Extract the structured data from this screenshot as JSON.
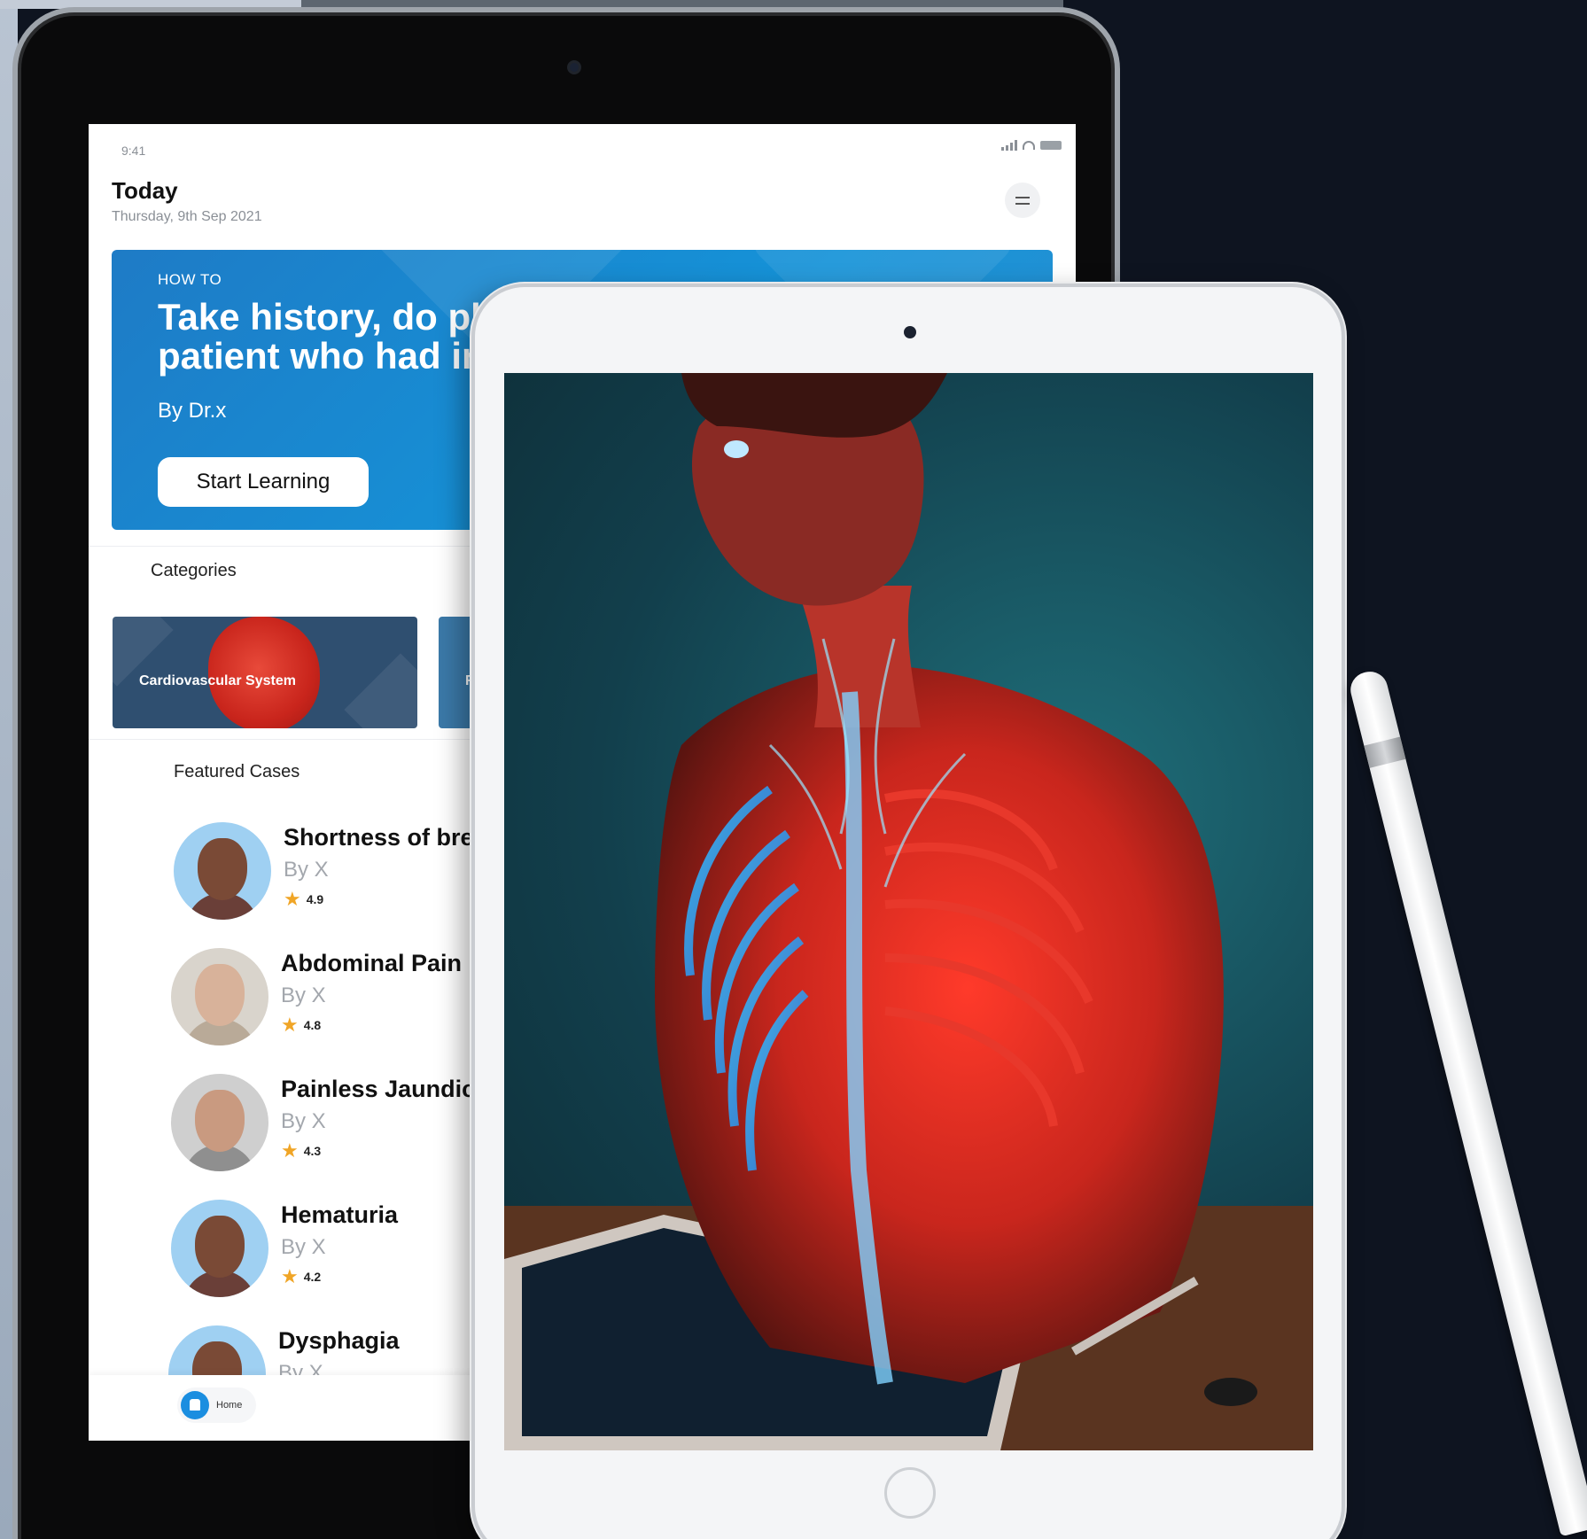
{
  "status_bar": {
    "time": "9:41"
  },
  "header": {
    "title": "Today",
    "date": "Thursday, 9th Sep 2021"
  },
  "hero": {
    "kicker": "HOW TO",
    "title": "Take history, do phy\npatient who had ing",
    "author": "By Dr.x",
    "button_label": "Start Learning"
  },
  "categories": {
    "heading": "Categories",
    "items": [
      {
        "label": "Cardiovascular System"
      },
      {
        "label": "Re"
      }
    ]
  },
  "featured": {
    "heading": "Featured Cases",
    "cases": [
      {
        "title": "Shortness of brea",
        "author": "By X",
        "rating": "4.9"
      },
      {
        "title": "Abdominal Pain",
        "author": "By X",
        "rating": "4.8"
      },
      {
        "title": "Painless Jaundice",
        "author": "By X",
        "rating": "4.3"
      },
      {
        "title": "Hematuria",
        "author": "By X",
        "rating": "4.2"
      },
      {
        "title": "Dysphagia",
        "author": "By X",
        "rating": ""
      }
    ]
  },
  "tabbar": {
    "home_label": "Home"
  },
  "colors": {
    "accent": "#1b8ee0",
    "hero": "#1593d8",
    "background": "#0e1420",
    "star": "#f0a526"
  },
  "icons": [
    "menu-icon",
    "home-icon",
    "star-icon",
    "signal-icon",
    "wifi-icon",
    "battery-icon"
  ]
}
